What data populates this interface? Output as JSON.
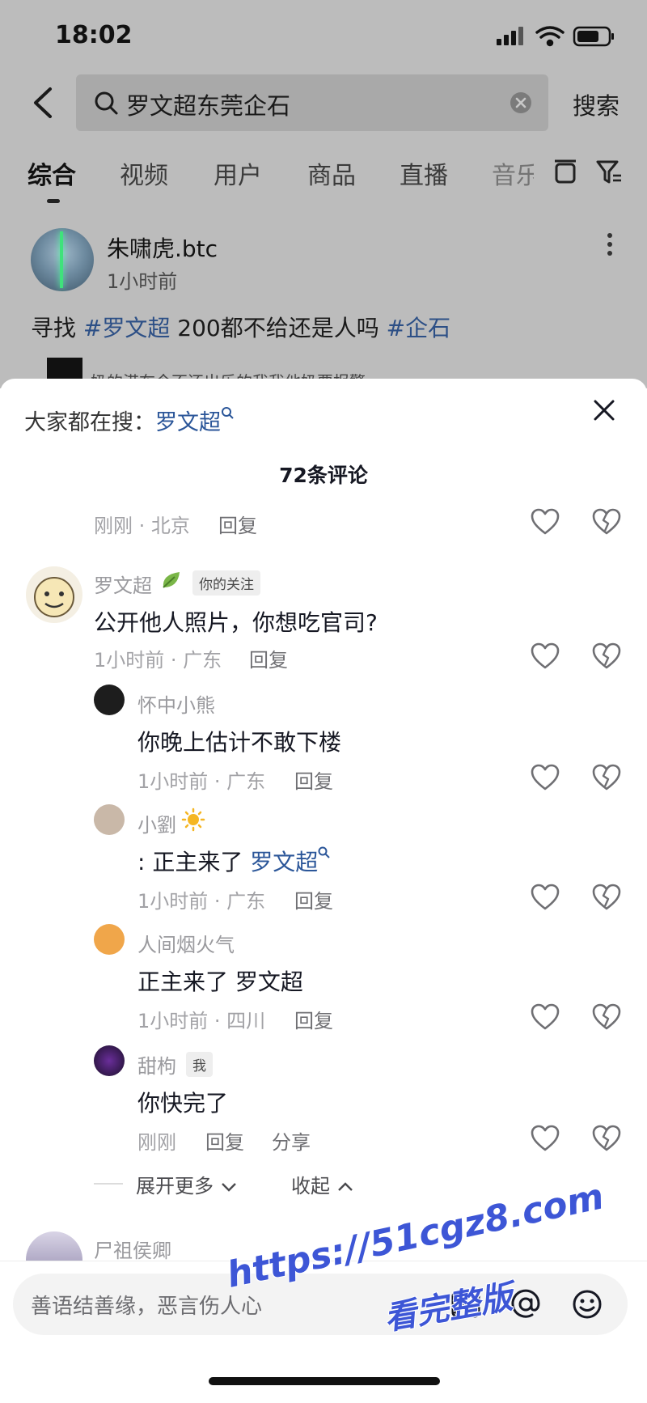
{
  "status_bar": {
    "time": "18:02"
  },
  "search": {
    "query": "罗文超东莞企石",
    "action_label": "搜索"
  },
  "tabs": [
    "综合",
    "视频",
    "用户",
    "商品",
    "直播",
    "音乐"
  ],
  "post": {
    "author": "朱啸虎.btc",
    "time": "1小时前",
    "text_prefix": "寻找 ",
    "tag1": "#罗文超",
    "text_middle": " 200都不给还是人吗 ",
    "tag2": "#企石",
    "preview_text": "奶的港布今不还出乐的我我他奶要报警"
  },
  "sheet": {
    "hint_prefix": "大家都在搜：",
    "hint_keyword": "罗文超",
    "title": "72条评论"
  },
  "top_comment_meta": {
    "meta": "刚刚 · 北京",
    "reply": "回复"
  },
  "comments": [
    {
      "name": "罗文超",
      "badge": "你的关注",
      "text": "公开他人照片，你想吃官司?",
      "meta": "1小时前 · 广东",
      "reply": "回复"
    }
  ],
  "replies": [
    {
      "name": "怀中小熊",
      "text": "你晚上估计不敢下楼",
      "meta": "1小时前 · 广东",
      "reply": "回复"
    },
    {
      "name": "小劉",
      "text_prefix": ": 正主来了 ",
      "text_link": "罗文超",
      "meta": "1小时前 · 广东",
      "reply": "回复"
    },
    {
      "name": "人间烟火气",
      "text": "正主来了  罗文超",
      "meta": "1小时前 · 四川",
      "reply": "回复"
    },
    {
      "name": "甜枸",
      "badge": "我",
      "text": "你快完了",
      "meta": "刚刚",
      "reply": "回复",
      "share": "分享"
    }
  ],
  "expand": {
    "more": "展开更多",
    "collapse": "收起"
  },
  "next_comment": {
    "name": "尸祖侯卿"
  },
  "input": {
    "placeholder": "善语结善缘，恶言伤人心"
  },
  "watermark": {
    "line1": "https://51cgz8.com",
    "line2": "看完整版"
  },
  "colors": {
    "accent_link": "#2b5699",
    "watermark": "#3d56d6"
  }
}
